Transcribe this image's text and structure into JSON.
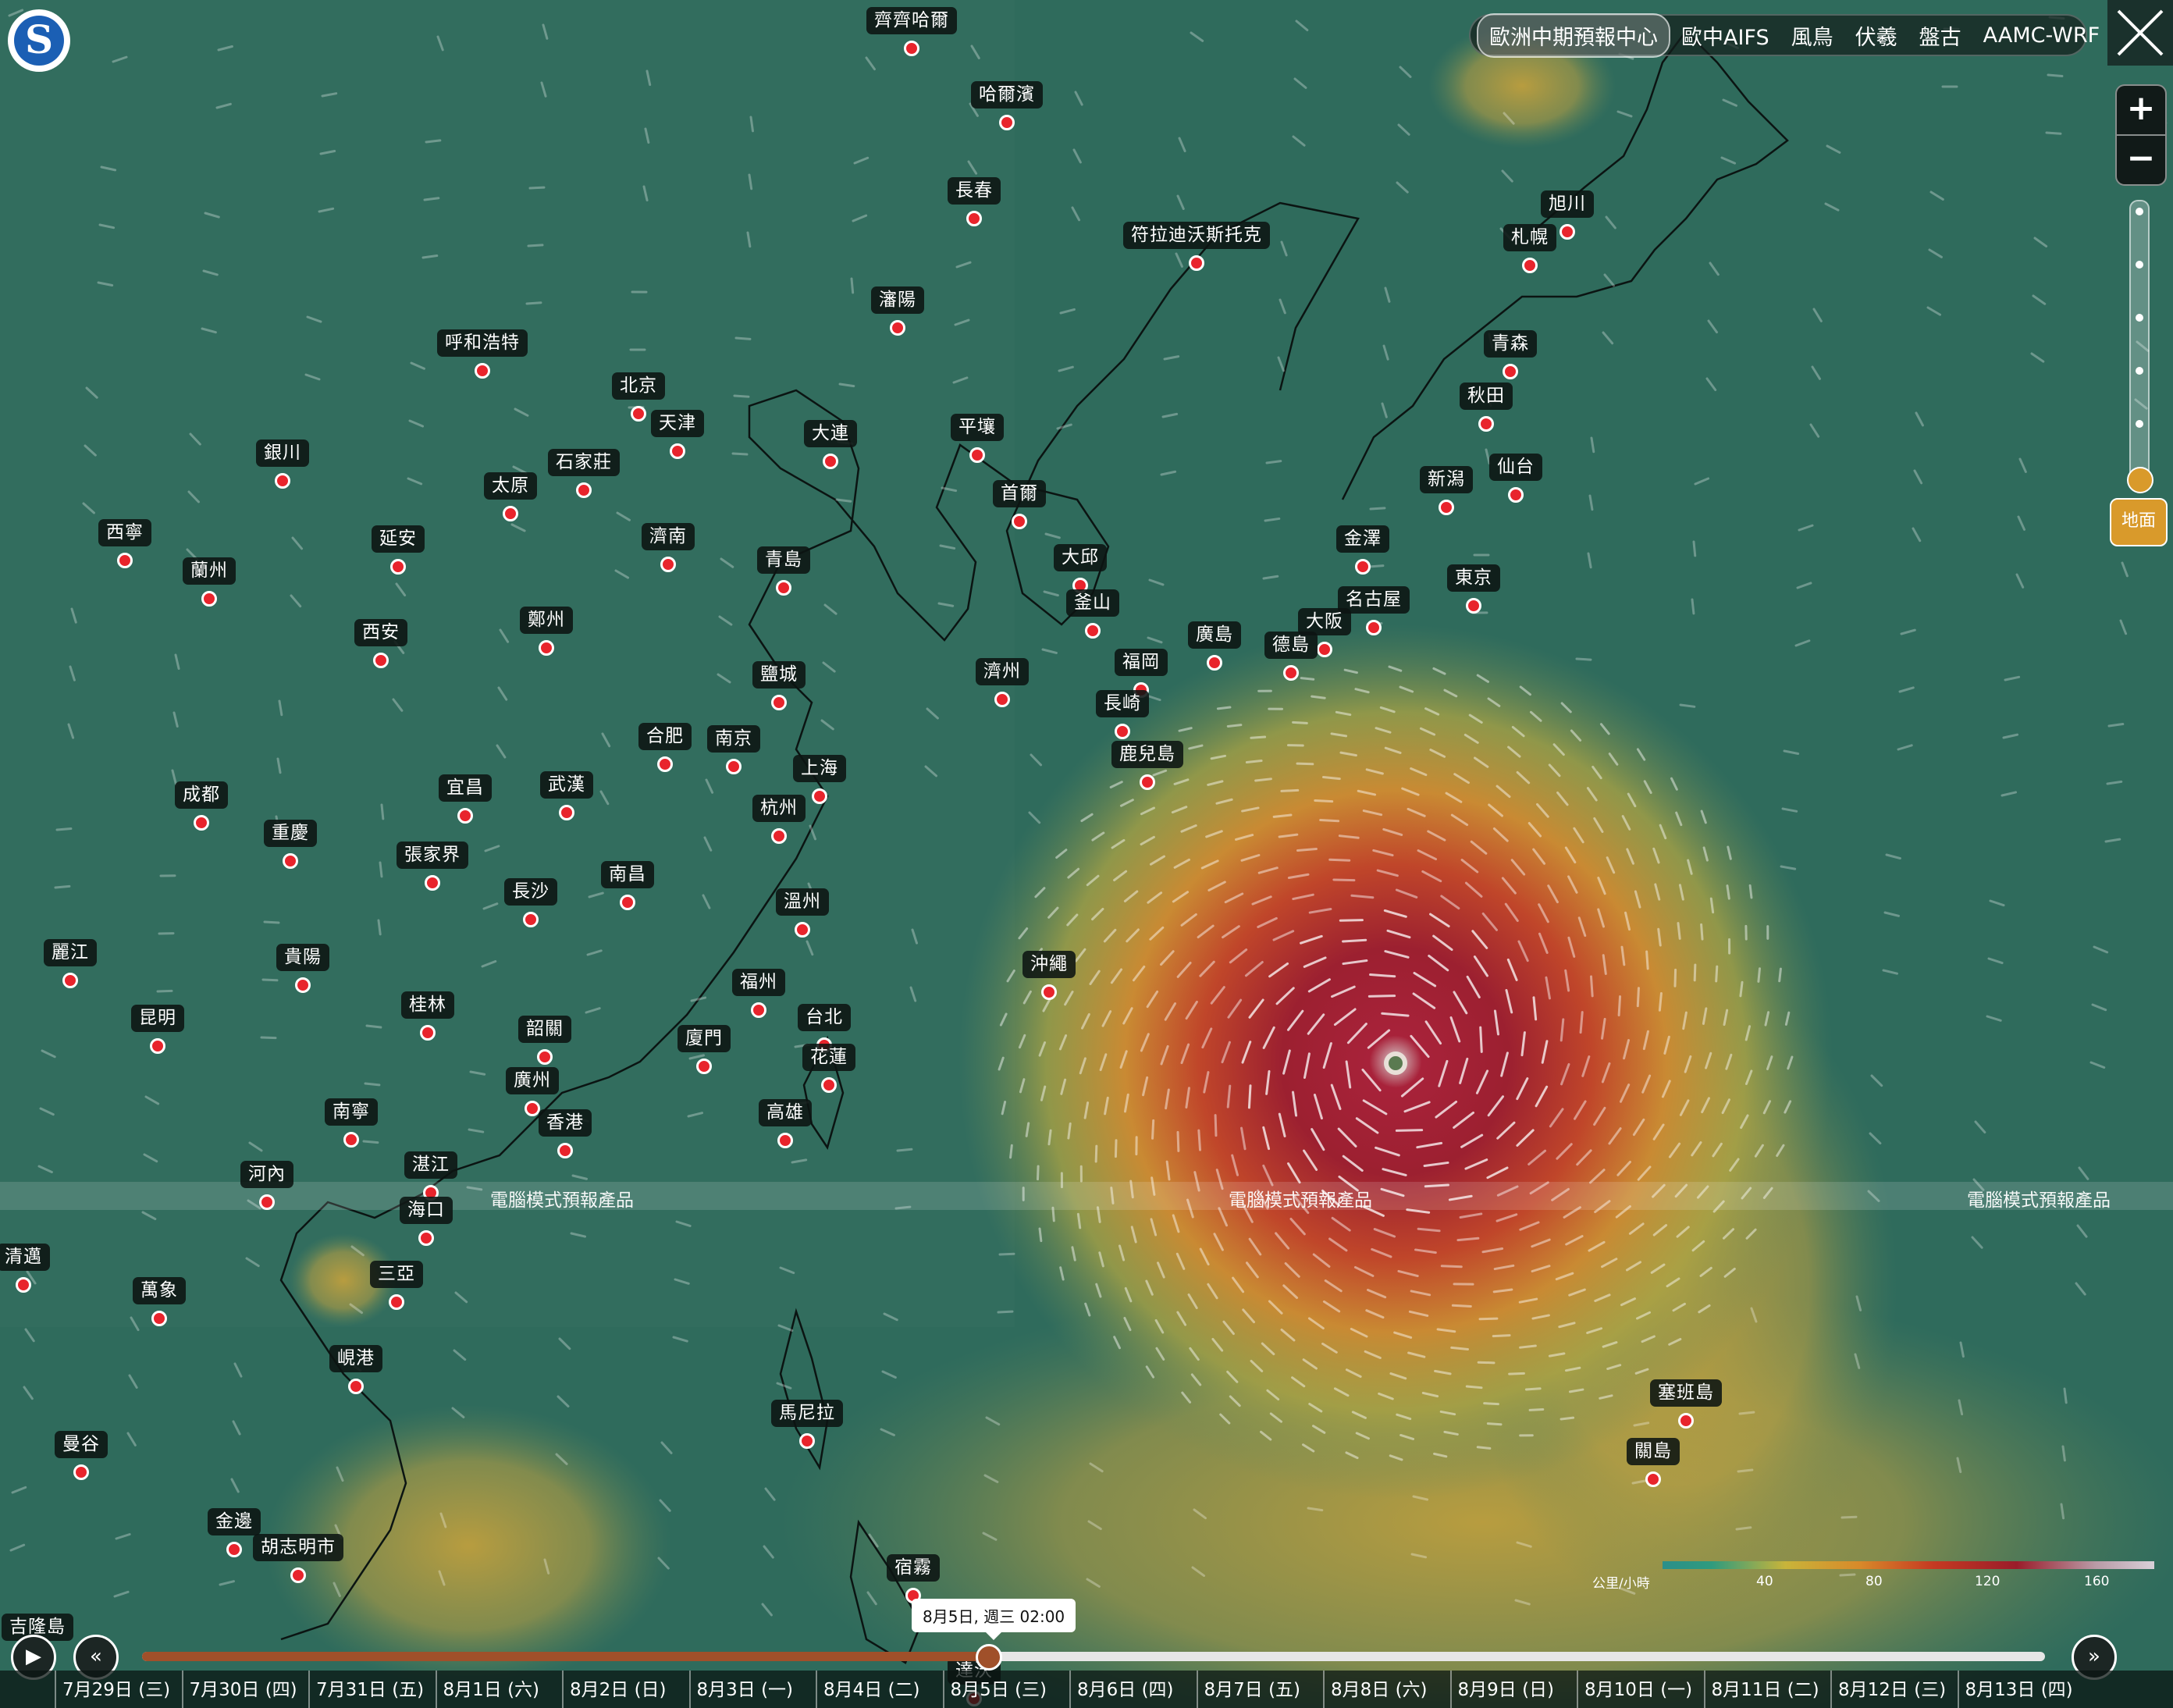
{
  "tabs": [
    "歐洲中期預報中心",
    "歐中AIFS",
    "風鳥",
    "伏羲",
    "盤古",
    "AAMC-WRF"
  ],
  "active_tab": "歐洲中期預報中心",
  "logo_icon": "weather-agency-logo",
  "zoom": {
    "in_label": "+",
    "out_label": "−"
  },
  "altitude": {
    "selected_label": "地面"
  },
  "watermark": "電腦模式預報產品",
  "legend": {
    "unit": "公里/小時",
    "ticks": [
      "40",
      "80",
      "120",
      "160"
    ],
    "colors": [
      "#2b8f8a",
      "#c8b43a",
      "#d88a2a",
      "#c53a22",
      "#9a1c2a",
      "#d8d0d8"
    ]
  },
  "timeline": {
    "current_time": "8月5日, 週三 02:00",
    "progress": 0.4437,
    "days": [
      "7月29日 (三)",
      "7月30日 (四)",
      "7月31日 (五)",
      "8月1日 (六)",
      "8月2日 (日)",
      "8月3日 (一)",
      "8月4日 (二)",
      "8月5日 (三)",
      "8月6日 (四)",
      "8月7日 (五)",
      "8月8日 (六)",
      "8月9日 (日)",
      "8月10日 (一)",
      "8月11日 (二)",
      "8月12日 (三)",
      "8月13日 (四)"
    ]
  },
  "cities": [
    "齊齊哈爾",
    "哈爾濱",
    "長春",
    "符拉迪沃斯托克",
    "旭川",
    "札幌",
    "瀋陽",
    "青森",
    "呼和浩特",
    "北京",
    "天津",
    "秋田",
    "銀川",
    "石家莊",
    "大連",
    "平壤",
    "仙台",
    "新潟",
    "太原",
    "首爾",
    "西寧",
    "延安",
    "濟南",
    "金澤",
    "蘭州",
    "青島",
    "大邱",
    "東京",
    "名古屋",
    "釜山",
    "鄭州",
    "西安",
    "大阪",
    "廣島",
    "德島",
    "濟州",
    "鹽城",
    "福岡",
    "長崎",
    "合肥",
    "南京",
    "上海",
    "鹿兒島",
    "成都",
    "宜昌",
    "武漢",
    "杭州",
    "重慶",
    "張家界",
    "南昌",
    "長沙",
    "溫州",
    "麗江",
    "貴陽",
    "沖繩",
    "福州",
    "桂林",
    "昆明",
    "台北",
    "韶關",
    "廈門",
    "花蓮",
    "廣州",
    "南寧",
    "香港",
    "高雄",
    "湛江",
    "河內",
    "海口",
    "清邁",
    "萬象",
    "三亞",
    "峴港",
    "塞班島",
    "馬尼拉",
    "曼谷",
    "關島",
    "金邊",
    "胡志明市",
    "宿霧",
    "達沃",
    "吉隆島"
  ]
}
